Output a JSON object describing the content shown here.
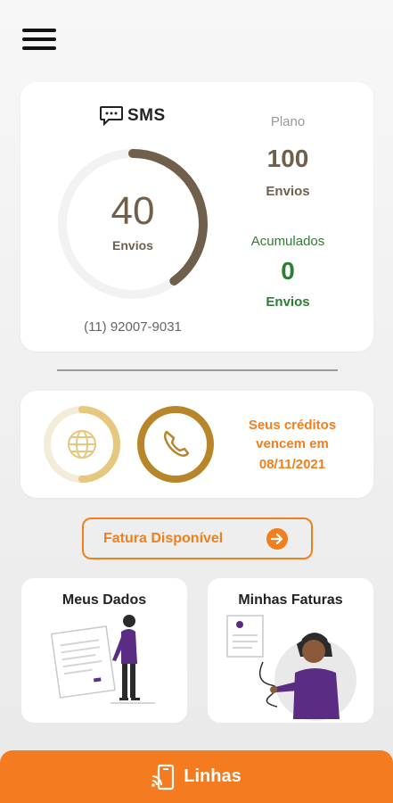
{
  "header": {
    "menu_icon": "hamburger-menu-icon"
  },
  "sms_card": {
    "title": "SMS",
    "title_icon": "chat-bubble-icon",
    "used_value": "40",
    "used_unit": "Envios",
    "gauge_fraction": 0.4,
    "phone_number": "(11) 92007-9031",
    "plano_label": "Plano",
    "plano_value": "100",
    "plano_unit": "Envios",
    "acumulados_label": "Acumulados",
    "acumulados_value": "0",
    "acumulados_unit": "Envios"
  },
  "credits_card": {
    "globe_icon": "globe-icon",
    "phone_icon": "phone-icon",
    "message_line1": "Seus créditos",
    "message_line2": "vencem em",
    "expiry_date": "08/11/2021"
  },
  "invoice_button": {
    "label": "Fatura Disponível",
    "icon": "arrow-right-circle-icon"
  },
  "tiles": [
    {
      "title": "Meus Dados"
    },
    {
      "title": "Minhas Faturas"
    }
  ],
  "bottom_bar": {
    "label": "Linhas",
    "icon": "mobile-signal-icon"
  },
  "colors": {
    "primary_orange": "#f47b20",
    "brown": "#6f5f4b",
    "green": "#2e7d32",
    "gold": "#e6c77e",
    "dark_gold": "#b8862a",
    "purple": "#5b2c83"
  }
}
